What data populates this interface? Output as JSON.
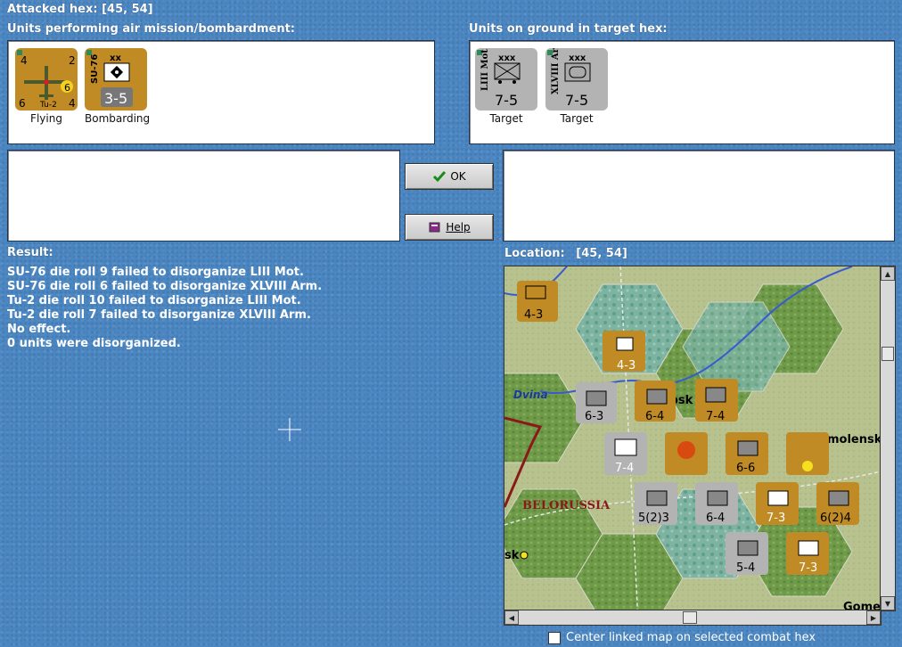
{
  "header": {
    "attacked_hex": "Attacked hex: [45, 54]"
  },
  "air_units": {
    "label": "Units performing air mission/bombardment:",
    "units": [
      {
        "name": "Tu-2",
        "status": "Flying",
        "stats_left": "4",
        "stats_right": "2",
        "stats_bl": "6",
        "stats_br": "4",
        "badge": "6"
      },
      {
        "name": "SU-76",
        "status": "Bombarding",
        "size": "xx",
        "strength": "3-5"
      }
    ]
  },
  "ground_units": {
    "label": "Units on ground in target hex:",
    "units": [
      {
        "name": "LIII Mot",
        "size": "xxx",
        "strength": "7-5",
        "status": "Target"
      },
      {
        "name": "XLVIII Arm",
        "size": "xxx",
        "strength": "7-5",
        "status": "Target"
      }
    ]
  },
  "buttons": {
    "ok": "OK",
    "help": "Help"
  },
  "result": {
    "label": "Result:",
    "lines": [
      "SU-76 die roll 9 failed to disorganize LIII Mot.",
      "SU-76 die roll 6 failed to disorganize XLVIII Arm.",
      "Tu-2 die roll 10 failed to disorganize LIII Mot.",
      "Tu-2 die roll 7 failed to disorganize XLVIII Arm.",
      "No effect.",
      "0 units were disorganized."
    ]
  },
  "location": {
    "label": "Location:",
    "value": "[45, 54]"
  },
  "map": {
    "labels": {
      "dvina": "Dvina",
      "belorussia": "BELORUSSIA",
      "smolensk": "molensk",
      "osk": "osk",
      "sk": "sk",
      "gome": "Gome"
    },
    "counters": [
      {
        "str": "4-3",
        "color": "orange"
      },
      {
        "str": "4-3",
        "color": "orange"
      },
      {
        "str": "6-3",
        "color": "gray"
      },
      {
        "str": "6-4",
        "color": "orange"
      },
      {
        "str": "7-4",
        "color": "orange"
      },
      {
        "str": "7-4",
        "color": "gray"
      },
      {
        "str": "6-6",
        "color": "orange"
      },
      {
        "str": "5(2)3",
        "color": "gray"
      },
      {
        "str": "6-4",
        "color": "gray"
      },
      {
        "str": "7-3",
        "color": "orange"
      },
      {
        "str": "6(2)4",
        "color": "orange"
      },
      {
        "str": "5-4",
        "color": "gray"
      },
      {
        "str": "7-3",
        "color": "orange"
      }
    ]
  },
  "footer": {
    "center_checkbox": "Center linked map on selected combat hex"
  }
}
